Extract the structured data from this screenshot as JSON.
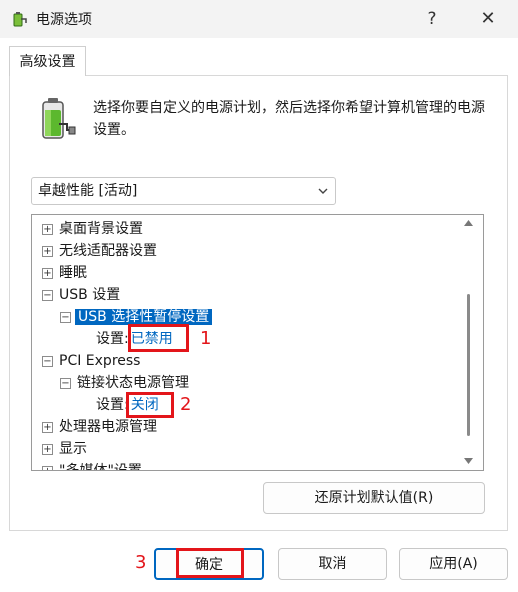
{
  "window": {
    "title": "电源选项",
    "help_label": "?",
    "close_label": "✕"
  },
  "tab": {
    "label": "高级设置"
  },
  "description": "选择你要自定义的电源计划，然后选择你希望计算机管理的电源设置。",
  "plan_select": {
    "value": "卓越性能 [活动]"
  },
  "tree": {
    "desktop_background": "桌面背景设置",
    "wireless_adapter": "无线适配器设置",
    "sleep": "睡眠",
    "usb": "USB 设置",
    "usb_selective_suspend": "USB 选择性暂停设置",
    "usb_setting_label": "设置:",
    "usb_setting_value": "已禁用",
    "pci_express": "PCI Express",
    "link_state_power": "链接状态电源管理",
    "pci_setting_label": "设置:",
    "pci_setting_value": "关闭",
    "processor_power": "处理器电源管理",
    "display": "显示",
    "multimedia": "\"多媒体\"设置"
  },
  "annotations": {
    "one": "1",
    "two": "2",
    "three": "3"
  },
  "buttons": {
    "restore_defaults": "还原计划默认值(R)",
    "ok": "确定",
    "cancel": "取消",
    "apply": "应用(A)"
  },
  "colors": {
    "accent": "#0067c0",
    "annotation_red": "#e3151a"
  },
  "icons": {
    "app": "power-options-icon",
    "plan": "battery-plug-icon"
  }
}
